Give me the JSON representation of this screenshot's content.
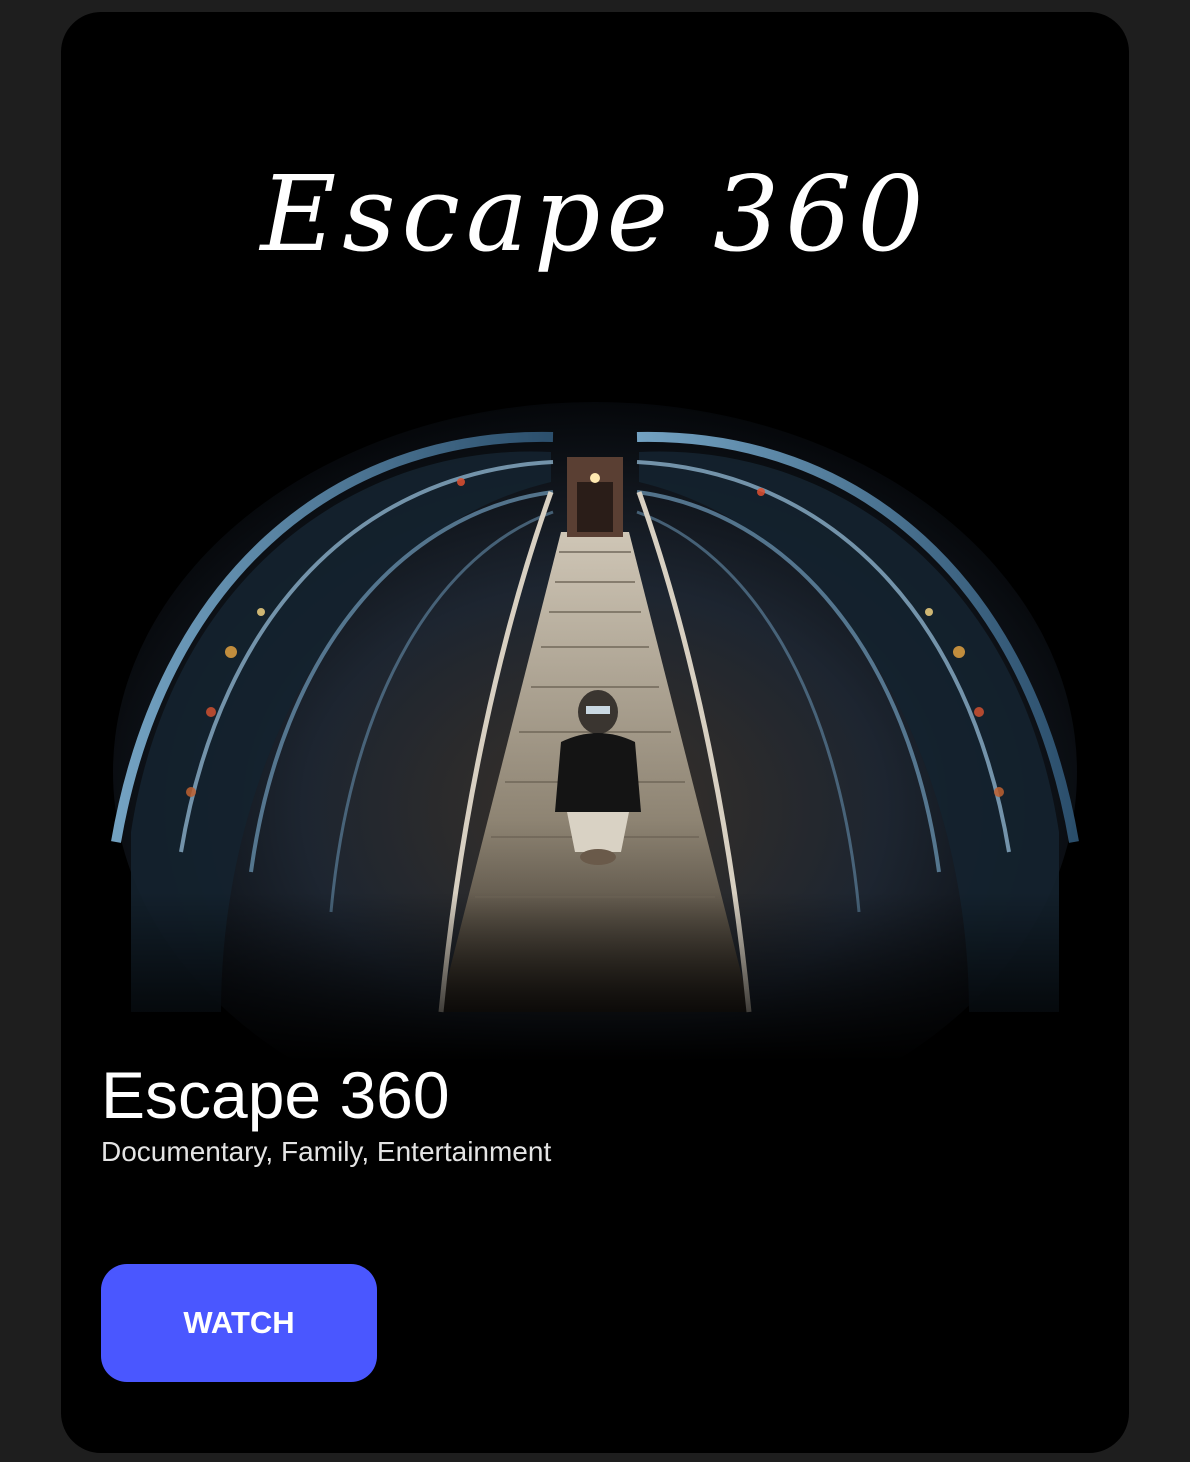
{
  "artwork": {
    "logo_text": "Escape 360",
    "subject": "fisheye-staircase-figure"
  },
  "show": {
    "title": "Escape 360",
    "genres": "Documentary, Family, Entertainment"
  },
  "actions": {
    "watch_label": "WATCH"
  },
  "colors": {
    "page_background": "#1e1e1e",
    "card_background": "#000000",
    "accent": "#4a57ff",
    "text_primary": "#ffffff",
    "text_secondary": "#e4e4e4"
  }
}
